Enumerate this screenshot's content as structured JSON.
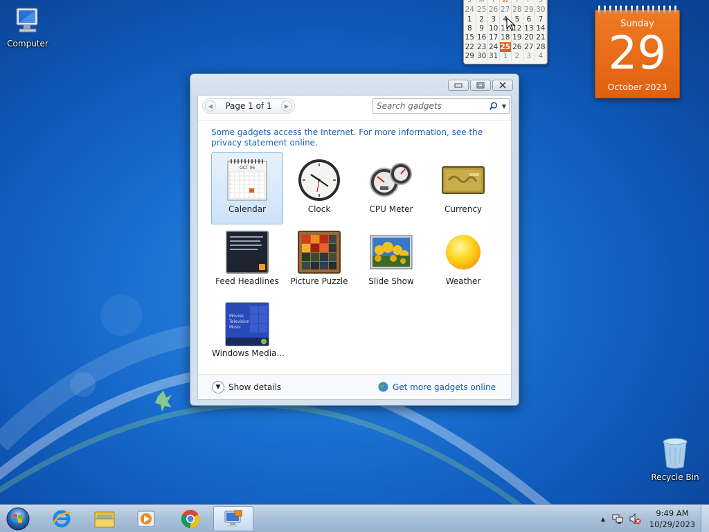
{
  "desktop": {
    "icons": [
      {
        "label": "Computer"
      },
      {
        "label": "Recycle Bin"
      }
    ]
  },
  "mini_calendar": {
    "dow": [
      "S",
      "M",
      "T",
      "W",
      "T",
      "F",
      "S"
    ],
    "rows": [
      [
        "24",
        "25",
        "26",
        "27",
        "28",
        "29",
        "30"
      ],
      [
        "1",
        "2",
        "3",
        "4",
        "5",
        "6",
        "7"
      ],
      [
        "8",
        "9",
        "10",
        "11",
        "12",
        "13",
        "14"
      ],
      [
        "15",
        "16",
        "17",
        "18",
        "19",
        "20",
        "21"
      ],
      [
        "22",
        "23",
        "24",
        "25",
        "26",
        "27",
        "28"
      ],
      [
        "29",
        "30",
        "31",
        "1",
        "2",
        "3",
        "4"
      ]
    ],
    "today": "25"
  },
  "date_gadget": {
    "weekday": "Sunday",
    "day": "29",
    "month_year": "October 2023"
  },
  "gadget_window": {
    "pager": {
      "label": "Page 1 of 1"
    },
    "search": {
      "placeholder": "Search gadgets"
    },
    "notice": "Some gadgets access the Internet.  For more information, see the privacy statement online.",
    "gadgets": [
      {
        "label": "Calendar",
        "icon": "calendar-icon",
        "selected": true
      },
      {
        "label": "Clock",
        "icon": "clock-icon",
        "selected": false
      },
      {
        "label": "CPU Meter",
        "icon": "cpu-meter-icon",
        "selected": false
      },
      {
        "label": "Currency",
        "icon": "currency-icon",
        "selected": false
      },
      {
        "label": "Feed Headlines",
        "icon": "feed-icon",
        "selected": false
      },
      {
        "label": "Picture Puzzle",
        "icon": "puzzle-icon",
        "selected": false
      },
      {
        "label": "Slide Show",
        "icon": "slideshow-icon",
        "selected": false
      },
      {
        "label": "Weather",
        "icon": "weather-icon",
        "selected": false
      },
      {
        "label": "Windows Media...",
        "icon": "media-center-icon",
        "selected": false
      }
    ],
    "media_center_lines": [
      "Movies",
      "Television",
      "Music"
    ],
    "footer": {
      "show_details": "Show details",
      "get_more": "Get more gadgets online"
    }
  },
  "taskbar": {
    "pinned": [
      "internet-explorer",
      "file-explorer",
      "media-player",
      "chrome",
      "gadgets-window"
    ],
    "clock": {
      "time": "9:49 AM",
      "date": "10/29/2023"
    }
  },
  "colors": {
    "accent_orange": "#e35d12",
    "link_blue": "#1a5fb4",
    "taskbar": "#a9c0d9"
  }
}
